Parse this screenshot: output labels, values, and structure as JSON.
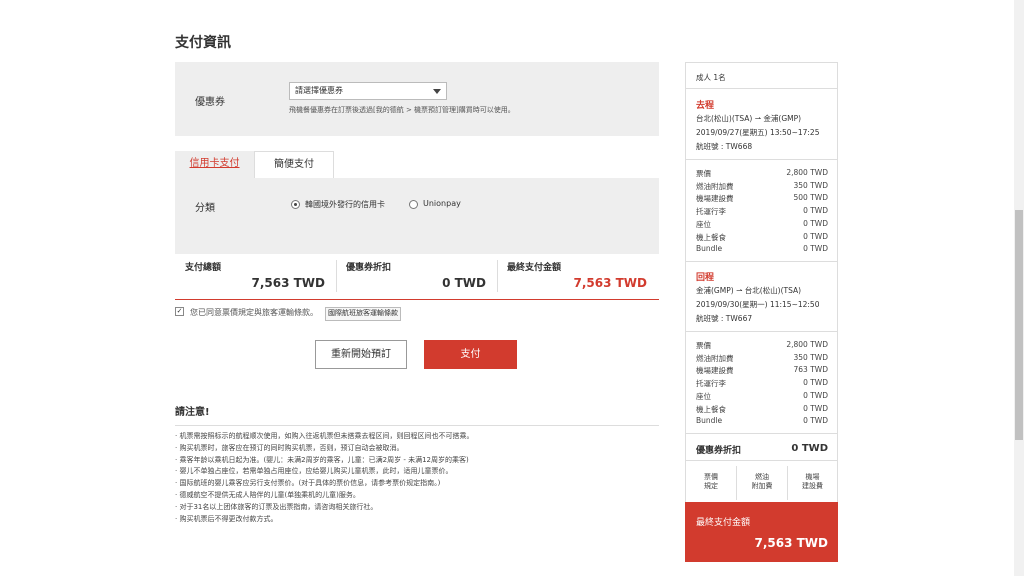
{
  "page_title": "支付資訊",
  "coupon": {
    "label": "優惠券",
    "select_value": "請選擇優惠券",
    "note": "飛機餐優惠券在訂票後透過[我的德航 > 機票預訂管理]購買時可以使用。"
  },
  "tabs": [
    {
      "label": "信用卡支付"
    },
    {
      "label": "簡便支付"
    }
  ],
  "method": {
    "label": "分類",
    "options": [
      {
        "label": "韓國境外發行的信用卡"
      },
      {
        "label": "Unionpay"
      }
    ]
  },
  "summary": {
    "total_label": "支付總額",
    "total_value": "7,563 TWD",
    "coupon_label": "優惠券折扣",
    "coupon_value": "0 TWD",
    "final_label": "最終支付金額",
    "final_value": "7,563 TWD"
  },
  "agree": {
    "check": "✓",
    "text": "您已同意票價規定與旅客運輸條款。",
    "rules_button": "國際航班旅客運輸條款"
  },
  "buttons": {
    "restart": "重新開始預訂",
    "pay": "支付"
  },
  "notice": {
    "title": "請注意!",
    "items": [
      "· 机票需按照标示的航程顺次使用，如购入往返机票但未搭乘去程区间，则回程区间也不可搭乘。",
      "· 购买机票时，旅客应在预订的同时购买机票，否则，预订自动会被取消。",
      "· 乘客年龄以乘机日起为准。(婴儿：未满2周岁的乘客，儿童：已满2周岁 - 未满12周岁的乘客)",
      "· 婴儿不单独占座位，若需单独占用座位，应给婴儿购买儿童机票，此时，适用儿童票价。",
      "· 国际航班的婴儿乘客应另行支付票价。(对于具体的票价信息，请参考票价规定指南。)",
      "· 德威航空不提供无成人陪伴的儿童(单独乘机的儿童)服务。",
      "· 对于31名以上团体旅客的订票及出票指南，请咨询相关旅行社。",
      "· 购买机票后不得更改付款方式。"
    ]
  },
  "panel": {
    "passengers": "成人 1名",
    "outbound": {
      "title": "去程",
      "from": "台北(松山)(TSA)",
      "to": "金浦(GMP)",
      "datetime": "2019/09/27(星期五) 13:50~17:25",
      "flight": "航班號 : TW668",
      "rows": [
        {
          "label": "票價",
          "value": "2,800 TWD"
        },
        {
          "label": "燃油附加費",
          "value": "350 TWD"
        },
        {
          "label": "機場建設費",
          "value": "500 TWD"
        },
        {
          "label": "托運行李",
          "value": "0 TWD"
        },
        {
          "label": "座位",
          "value": "0 TWD"
        },
        {
          "label": "機上餐食",
          "value": "0 TWD"
        },
        {
          "label": "Bundle",
          "value": "0 TWD"
        }
      ]
    },
    "return": {
      "title": "回程",
      "from": "金浦(GMP)",
      "to": "台北(松山)(TSA)",
      "datetime": "2019/09/30(星期一) 11:15~12:50",
      "flight": "航班號 : TW667",
      "rows": [
        {
          "label": "票價",
          "value": "2,800 TWD"
        },
        {
          "label": "燃油附加費",
          "value": "350 TWD"
        },
        {
          "label": "機場建設費",
          "value": "763 TWD"
        },
        {
          "label": "托運行李",
          "value": "0 TWD"
        },
        {
          "label": "座位",
          "value": "0 TWD"
        },
        {
          "label": "機上餐食",
          "value": "0 TWD"
        },
        {
          "label": "Bundle",
          "value": "0 TWD"
        }
      ]
    },
    "coupon_label": "優惠券折扣",
    "coupon_value": "0 TWD",
    "breakdown": [
      {
        "line1": "票價",
        "line2": "規定"
      },
      {
        "line1": "燃油",
        "line2": "附加費"
      },
      {
        "line1": "機場",
        "line2": "建設費"
      }
    ],
    "final_label": "最終支付金額",
    "final_value": "7,563 TWD"
  },
  "colors": {
    "accent": "#d23b2e",
    "panel_gray": "#eeeeee"
  }
}
